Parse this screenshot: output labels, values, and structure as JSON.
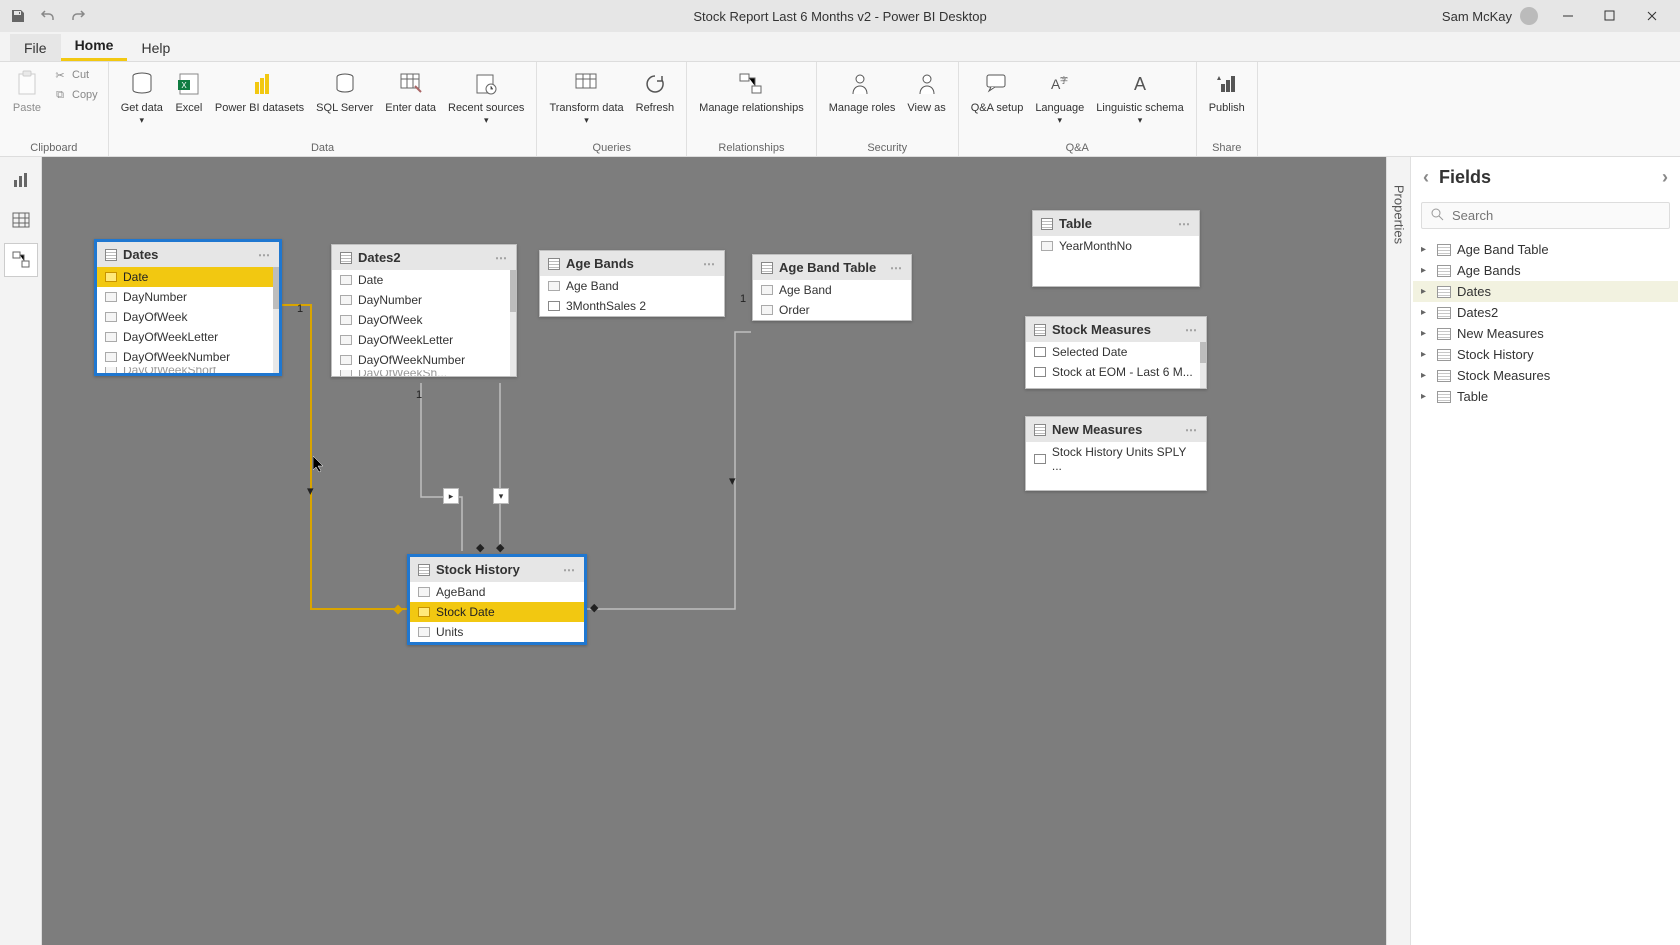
{
  "titlebar": {
    "title": "Stock Report Last 6 Months v2 - Power BI Desktop",
    "user": "Sam McKay"
  },
  "menu": {
    "file": "File",
    "home": "Home",
    "help": "Help"
  },
  "ribbon": {
    "clipboard": {
      "paste": "Paste",
      "cut": "Cut",
      "copy": "Copy",
      "label": "Clipboard"
    },
    "data": {
      "get": "Get data",
      "excel": "Excel",
      "pbi": "Power BI datasets",
      "sql": "SQL Server",
      "enter": "Enter data",
      "recent": "Recent sources",
      "label": "Data"
    },
    "queries": {
      "transform": "Transform data",
      "refresh": "Refresh",
      "label": "Queries"
    },
    "rel": {
      "manage": "Manage relationships",
      "label": "Relationships"
    },
    "security": {
      "roles": "Manage roles",
      "view": "View as",
      "label": "Security"
    },
    "qa": {
      "setup": "Q&A setup",
      "lang": "Language",
      "schema": "Linguistic schema",
      "label": "Q&A"
    },
    "share": {
      "publish": "Publish",
      "label": "Share"
    }
  },
  "properties_label": "Properties",
  "fields_panel": {
    "title": "Fields",
    "search_placeholder": "Search",
    "items": [
      {
        "label": "Age Band Table"
      },
      {
        "label": "Age Bands"
      },
      {
        "label": "Dates",
        "selected": true
      },
      {
        "label": "Dates2"
      },
      {
        "label": "New Measures"
      },
      {
        "label": "Stock History"
      },
      {
        "label": "Stock Measures"
      },
      {
        "label": "Table"
      }
    ]
  },
  "tables": {
    "dates": {
      "title": "Dates",
      "fields": [
        "Date",
        "DayNumber",
        "DayOfWeek",
        "DayOfWeekLetter",
        "DayOfWeekNumber",
        "DayOfWeekShort"
      ],
      "highlight": 0
    },
    "dates2": {
      "title": "Dates2",
      "fields": [
        "Date",
        "DayNumber",
        "DayOfWeek",
        "DayOfWeekLetter",
        "DayOfWeekNumber",
        "DayOfWeekSh..."
      ]
    },
    "agebands": {
      "title": "Age Bands",
      "fields": [
        "Age Band",
        "3MonthSales 2"
      ]
    },
    "agebandtable": {
      "title": "Age Band Table",
      "fields": [
        "Age Band",
        "Order"
      ]
    },
    "table": {
      "title": "Table",
      "fields": [
        "YearMonthNo"
      ]
    },
    "stockmeasures": {
      "title": "Stock Measures",
      "fields": [
        "Selected Date",
        "Stock at EOM - Last 6 M..."
      ]
    },
    "newmeasures": {
      "title": "New Measures",
      "fields": [
        "Stock History Units SPLY ..."
      ]
    },
    "stockhistory": {
      "title": "Stock History",
      "fields": [
        "AgeBand",
        "Stock Date",
        "Units"
      ],
      "highlight": 1
    }
  },
  "cardinality_one": "1"
}
